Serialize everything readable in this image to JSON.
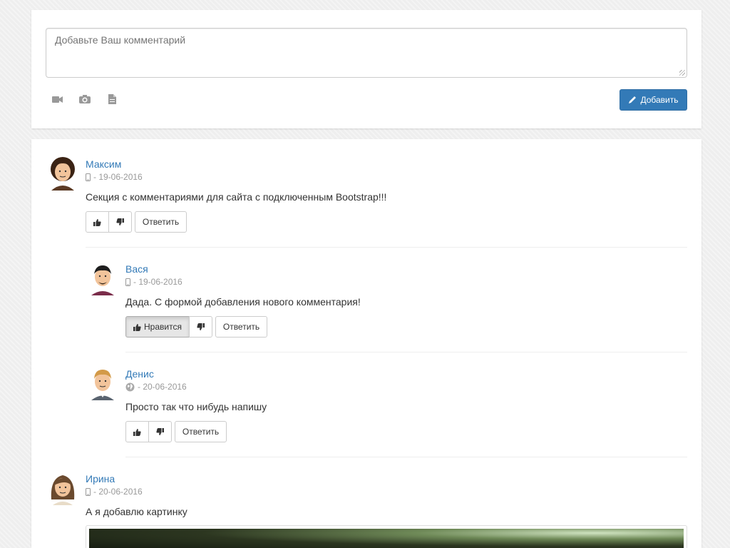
{
  "form": {
    "placeholder": "Добавьте Ваш комментарий",
    "add_label": "Добавить",
    "attach_icons": [
      "video-camera-icon",
      "camera-icon",
      "file-icon"
    ]
  },
  "colors": {
    "accent": "#337ab7",
    "muted": "#999999"
  },
  "comments": [
    {
      "author": "Максим",
      "device_icon": "mobile-icon",
      "date": "- 19-06-2016",
      "text": "Секция с комментариями для сайта с подключенным Bootstrap!!!",
      "reply_label": "Ответить"
    },
    {
      "author": "Вася",
      "device_icon": "mobile-icon",
      "date": "- 19-06-2016",
      "text": "Дада. С формой добавления нового комментария!",
      "like_label": "Нравится",
      "liked": true,
      "reply_label": "Ответить"
    },
    {
      "author": "Денис",
      "device_icon": "globe-icon",
      "date": "- 20-06-2016",
      "text": "Просто так что нибудь напишу",
      "reply_label": "Ответить"
    },
    {
      "author": "Ирина",
      "device_icon": "mobile-icon",
      "date": "- 20-06-2016",
      "text": "А я добавлю картинку"
    }
  ]
}
